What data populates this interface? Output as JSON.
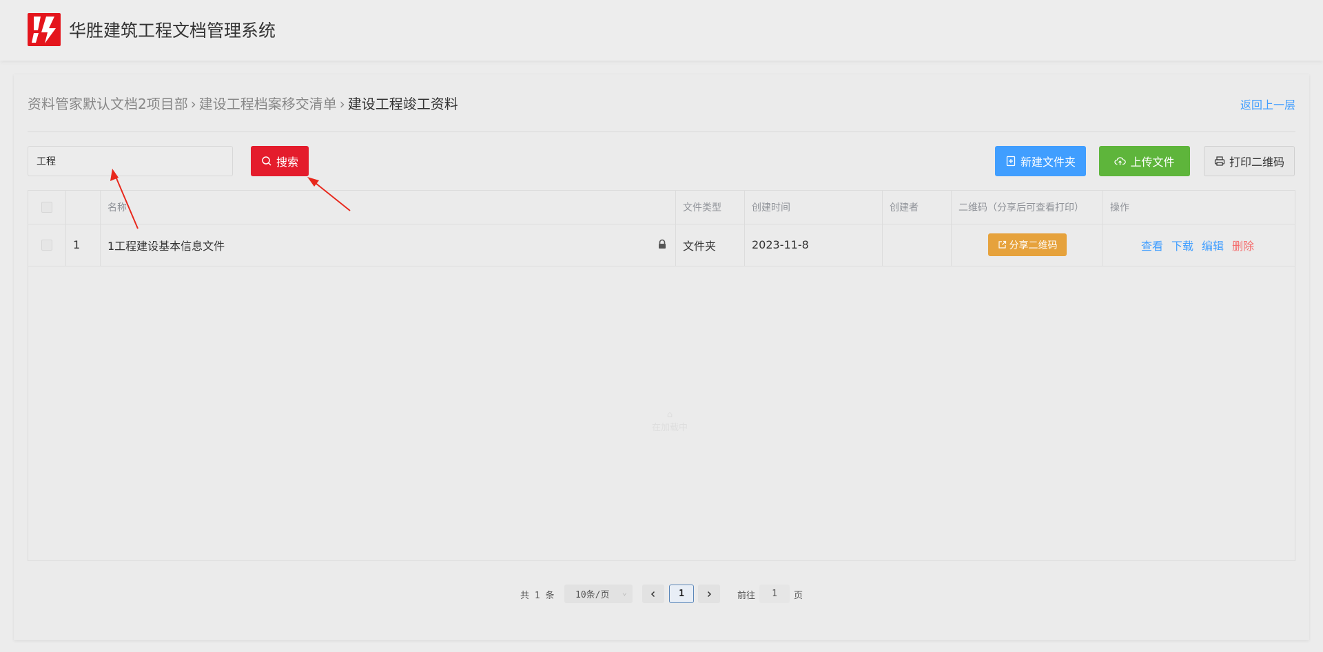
{
  "app": {
    "title": "华胜建筑工程文档管理系统",
    "brand_color": "#e4151c"
  },
  "breadcrumb": {
    "items": [
      "资料管家默认文档2项目部",
      "建设工程档案移交清单"
    ],
    "current": "建设工程竣工资料",
    "back_label": "返回上一层"
  },
  "toolbar": {
    "search_value": "工程",
    "search_label": "搜索",
    "new_folder_label": "新建文件夹",
    "upload_label": "上传文件",
    "print_qr_label": "打印二维码"
  },
  "table": {
    "columns": [
      "名称",
      "文件类型",
      "创建时间",
      "创建者",
      "二维码（分享后可查看打印）",
      "操作"
    ],
    "rows": [
      {
        "index": "1",
        "name": "1工程建设基本信息文件",
        "type": "文件夹",
        "created": "2023-11-8",
        "creator": "",
        "qr_label": "分享二维码",
        "actions": {
          "view": "查看",
          "download": "下载",
          "edit": "编辑",
          "delete": "删除"
        }
      }
    ],
    "empty_text": "在加载中"
  },
  "pagination": {
    "total_text": "共 1 条",
    "page_size": "10条/页",
    "current_page": "1",
    "goto_label": "前往",
    "goto_value": "1",
    "goto_unit": "页"
  },
  "colors": {
    "primary": "#409eff",
    "search": "#e41c2c",
    "upload": "#5eb53b",
    "qr": "#e6a23c",
    "danger": "#f56c6c",
    "annotation": "#e8281c"
  }
}
